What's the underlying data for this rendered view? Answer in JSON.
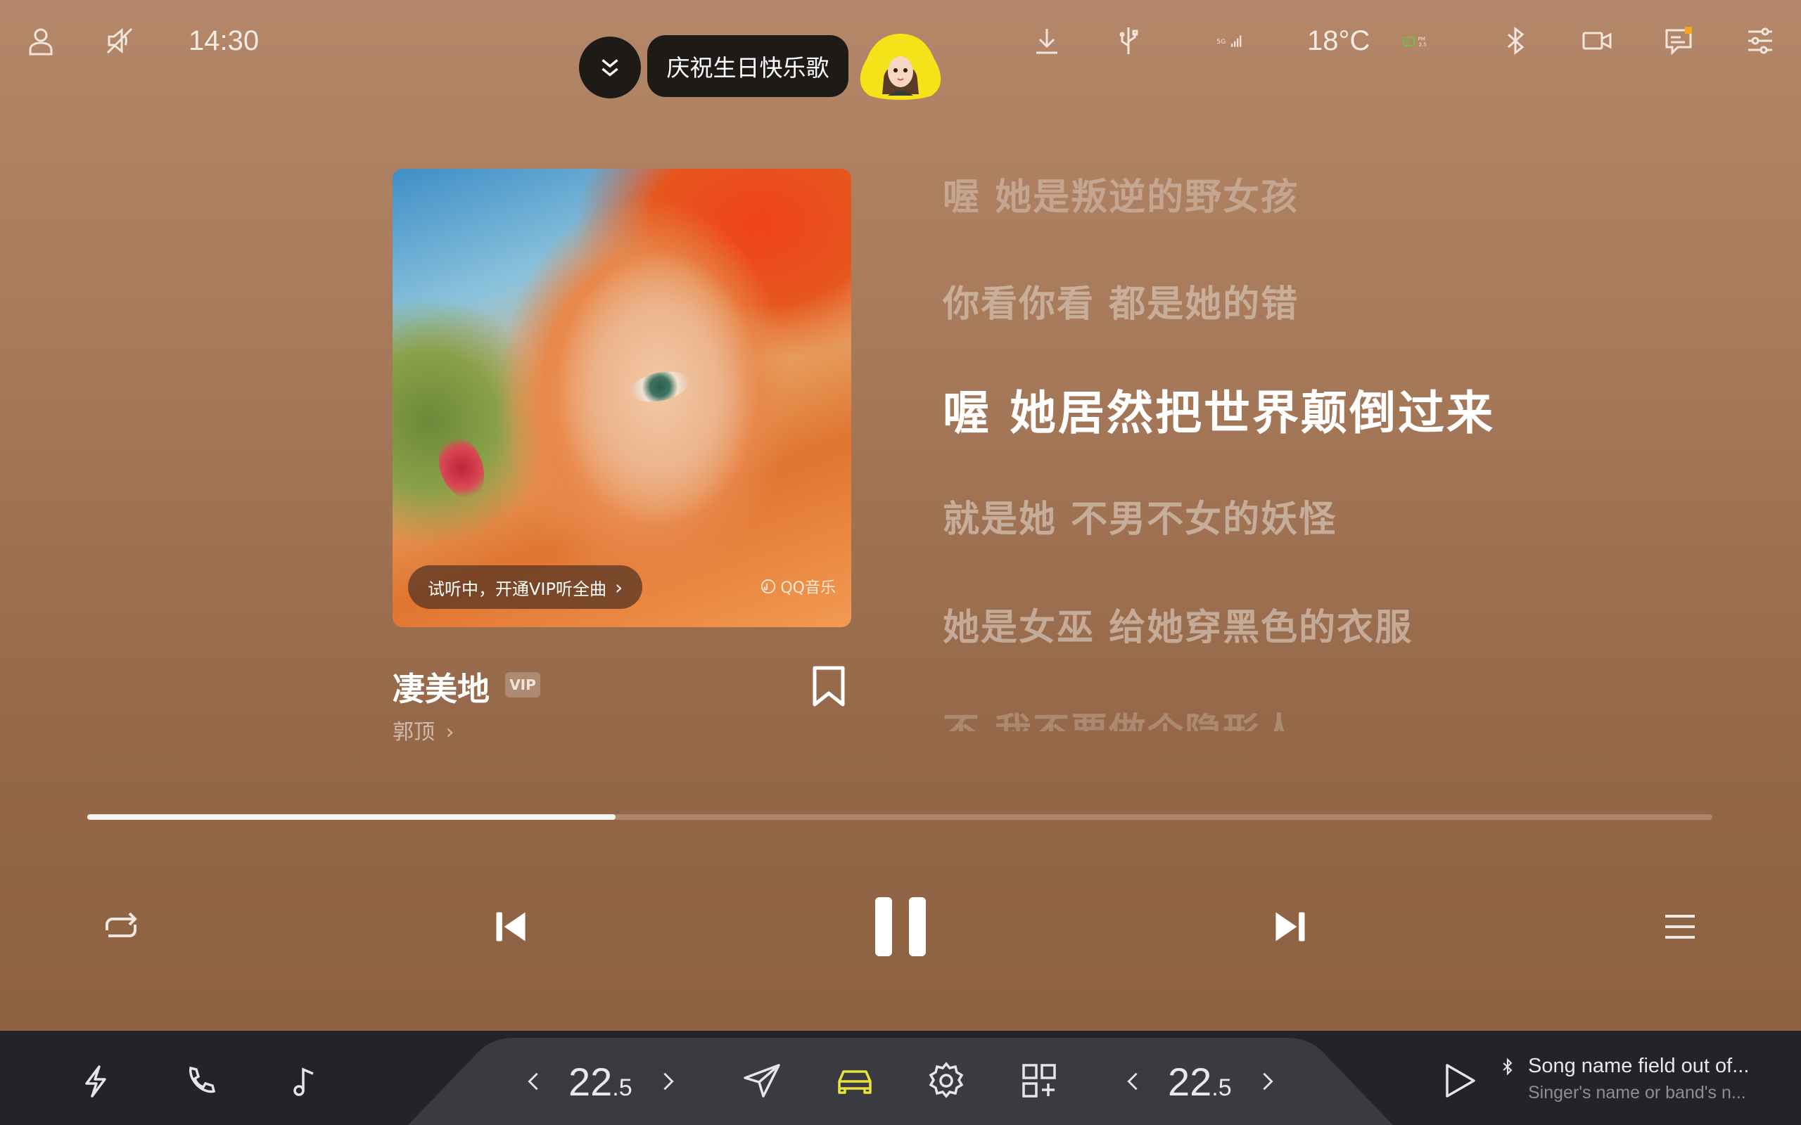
{
  "status_bar": {
    "time": "14:30",
    "temperature": "18°C",
    "network": "5G",
    "pm_label_top": "PM",
    "pm_label_bottom": "2.5",
    "icons": [
      "user-icon",
      "mute-icon",
      "download-icon",
      "usb-icon",
      "signal-icon",
      "air-quality-icon",
      "bluetooth-icon",
      "camera-icon",
      "message-icon",
      "settings-sliders-icon"
    ]
  },
  "notification": {
    "song_label": "庆祝生日快乐歌"
  },
  "player": {
    "trial_chip": "试听中，开通VIP听全曲",
    "trial_chevron": "›",
    "watermark": "QQ音乐",
    "song_title": "凄美地",
    "vip_badge": "VIP",
    "artist": "郭顶",
    "artist_chevron": "›",
    "progress_fraction": 0.325
  },
  "lyrics": [
    "喔 她是叛逆的野女孩",
    "你看你看 都是她的错",
    "喔 她居然把世界颠倒过来",
    "就是她 不男不女的妖怪",
    "她是女巫 给她穿黑色的衣服",
    "不 我不要做个隐形人"
  ],
  "dock": {
    "left_temp": "22",
    "left_temp_decimal": ".5",
    "right_temp": "22",
    "right_temp_decimal": ".5",
    "now_playing_title": "Song name field out of...",
    "now_playing_artist": "Singer's name or band's n..."
  },
  "colors": {
    "background_top": "#b5876a",
    "background_bottom": "#8a5f40",
    "dock": "#232427",
    "active_car_icon": "#e8e33a",
    "pm_green": "#5cd03a",
    "avatar_yellow": "#f5e31a"
  }
}
